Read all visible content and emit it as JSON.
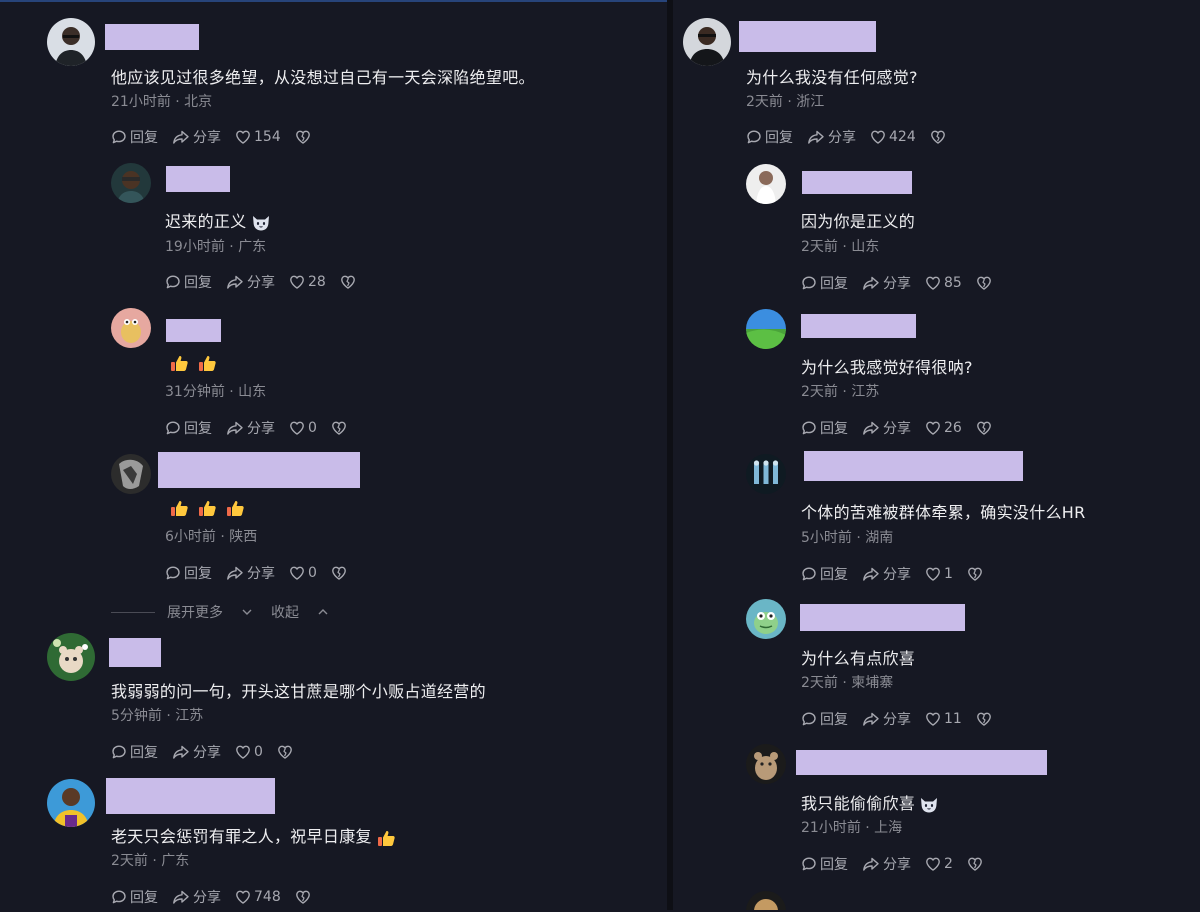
{
  "ui": {
    "reply": "回复",
    "share": "分享",
    "expand_more": "展开更多",
    "collapse": "收起"
  },
  "left": [
    {
      "text": "他应该见过很多绝望，从没想过自己有一天会深陷绝望吧。",
      "meta": "21小时前 · 北京",
      "likes": "154"
    },
    {
      "text": "迟来的正义",
      "meta": "19小时前 · 广东",
      "likes": "28"
    },
    {
      "text": "",
      "meta": "31分钟前 · 山东",
      "likes": "0"
    },
    {
      "text": "",
      "meta": "6小时前 · 陕西",
      "likes": "0"
    },
    {
      "text": "我弱弱的问一句，开头这甘蔗是哪个小贩占道经营的",
      "meta": "5分钟前 · 江苏",
      "likes": "0"
    },
    {
      "text": "老天只会惩罚有罪之人，祝早日康复",
      "meta": "2天前 · 广东",
      "likes": "748"
    }
  ],
  "right": [
    {
      "text": "为什么我没有任何感觉?",
      "meta": "2天前 · 浙江",
      "likes": "424"
    },
    {
      "text": "因为你是正义的",
      "meta": "2天前 · 山东",
      "likes": "85"
    },
    {
      "text": "为什么我感觉好得很呐?",
      "meta": "2天前 · 江苏",
      "likes": "26"
    },
    {
      "text": "个体的苦难被群体牵累，确实没什么HR",
      "meta": "5小时前 · 湖南",
      "likes": "1"
    },
    {
      "text": "为什么有点欣喜",
      "meta": "2天前 · 柬埔寨",
      "likes": "11"
    },
    {
      "text": "我只能偷偷欣喜",
      "meta": "21小时前 · 上海",
      "likes": "2"
    }
  ],
  "icons": [
    "reply-icon",
    "share-icon",
    "heart-icon",
    "broken-heart-icon",
    "thumbs-up-emoji",
    "cat-emoji",
    "chevron-down-icon",
    "chevron-up-icon"
  ],
  "colors": {
    "background": "#161823",
    "redaction": "#c9bce9",
    "meta_text": "#8a8b93"
  }
}
